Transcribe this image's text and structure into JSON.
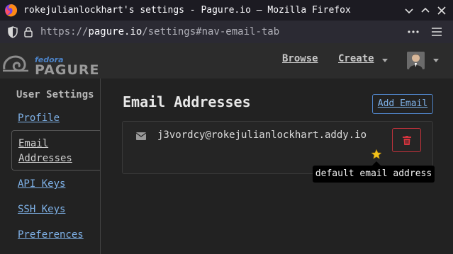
{
  "window": {
    "title": "rokejulianlockhart's settings - Pagure.io — Mozilla Firefox"
  },
  "urlbar": {
    "prefix": "https://",
    "host": "pagure.io",
    "path": "/settings#nav-email-tab"
  },
  "header": {
    "logo_small": "fedora",
    "logo_main": "PAGURE",
    "nav": [
      {
        "label": "Browse"
      },
      {
        "label": "Create"
      }
    ]
  },
  "sidebar": {
    "heading": "User Settings",
    "items": [
      {
        "label": "Profile"
      },
      {
        "label": "Email Addresses"
      },
      {
        "label": "API Keys"
      },
      {
        "label": "SSH Keys"
      },
      {
        "label": "Preferences"
      }
    ]
  },
  "main": {
    "title": "Email Addresses",
    "add_email_label": "Add Email",
    "emails": [
      {
        "address": "j3vordcy@rokejulianlockhart.addy.io"
      }
    ],
    "tooltip": "default email address"
  },
  "colors": {
    "link": "#7fb2e8",
    "danger": "#c0323b",
    "star": "#f2c21b",
    "primary_border": "#4f82c5"
  },
  "icons": [
    "firefox-logo-icon",
    "chevron-down-icon",
    "chevron-up-icon",
    "close-icon",
    "shield-icon",
    "lock-icon",
    "more-icon",
    "hamburger-menu-icon",
    "pagure-logo-icon",
    "envelope-icon",
    "trash-icon",
    "star-icon"
  ]
}
